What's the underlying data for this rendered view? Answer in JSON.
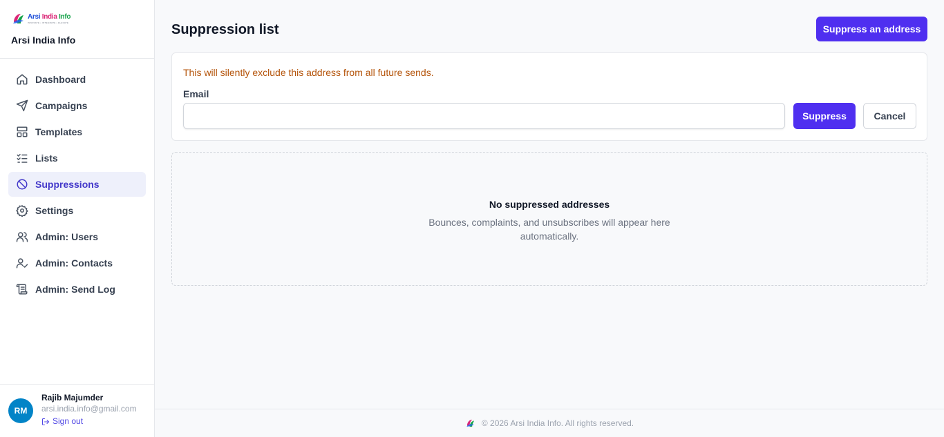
{
  "brand": {
    "logo_main_1": "Arsi",
    "logo_main_2": "India",
    "logo_main_3": "Info",
    "logo_tagline": "INNOVATE • INTEGRATE • ELEVATE",
    "name": "Arsi India Info"
  },
  "sidebar": {
    "items": [
      {
        "label": "Dashboard",
        "icon": "home-icon"
      },
      {
        "label": "Campaigns",
        "icon": "send-icon"
      },
      {
        "label": "Templates",
        "icon": "layout-icon"
      },
      {
        "label": "Lists",
        "icon": "checklist-icon"
      },
      {
        "label": "Suppressions",
        "icon": "ban-icon",
        "active": true
      },
      {
        "label": "Settings",
        "icon": "gear-icon"
      },
      {
        "label": "Admin: Users",
        "icon": "users-icon"
      },
      {
        "label": "Admin: Contacts",
        "icon": "user-check-icon"
      },
      {
        "label": "Admin: Send Log",
        "icon": "scroll-icon"
      }
    ]
  },
  "user": {
    "initials": "RM",
    "name": "Rajib Majumder",
    "email": "arsi.india.info@gmail.com",
    "signout_label": "Sign out"
  },
  "header": {
    "title": "Suppression list",
    "action_label": "Suppress an address"
  },
  "form": {
    "warning": "This will silently exclude this address from all future sends.",
    "email_label": "Email",
    "email_value": "",
    "email_placeholder": "",
    "submit_label": "Suppress",
    "cancel_label": "Cancel"
  },
  "empty_state": {
    "title": "No suppressed addresses",
    "description": "Bounces, complaints, and unsubscribes will appear here automatically."
  },
  "footer": {
    "text": "© 2026 Arsi India Info. All rights reserved."
  },
  "colors": {
    "primary": "#4f2ff0",
    "active_nav_bg": "#eef0fb",
    "active_nav_text": "#4338ca",
    "warning_text": "#b45309",
    "avatar_bg": "#0284c7"
  }
}
